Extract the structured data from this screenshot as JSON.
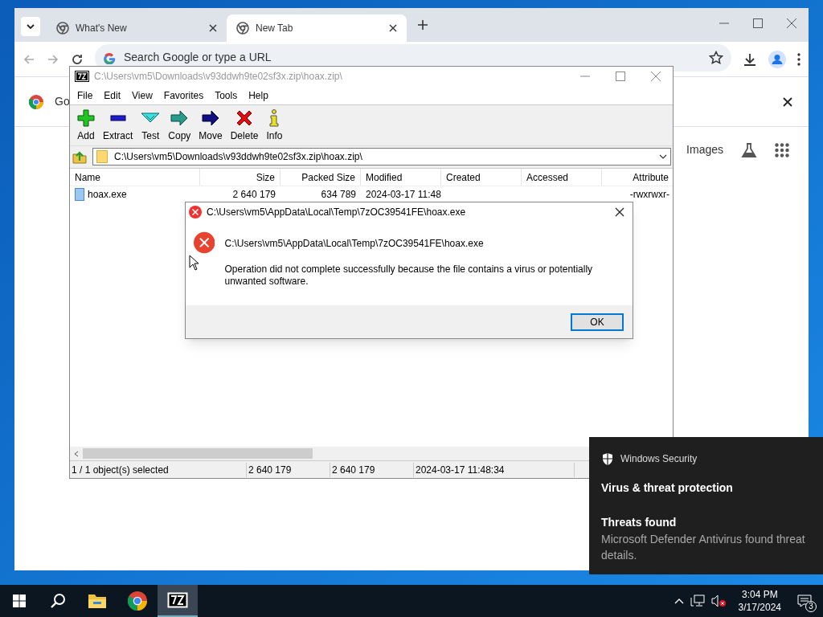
{
  "browser": {
    "tabs": [
      {
        "title": "What's New",
        "selected": false
      },
      {
        "title": "New Tab",
        "selected": true
      }
    ],
    "omnibox": {
      "placeholder": "Search Google or type a URL"
    },
    "banner": {
      "text": "Go"
    },
    "page_links": [
      "Images"
    ]
  },
  "archiver": {
    "title": "C:\\Users\\vm5\\Downloads\\v93ddwh9te02sf3x.zip\\hoax.zip\\",
    "menu": [
      "File",
      "Edit",
      "View",
      "Favorites",
      "Tools",
      "Help"
    ],
    "toolbar": [
      {
        "label": "Add",
        "kind": "add"
      },
      {
        "label": "Extract",
        "kind": "extract"
      },
      {
        "label": "Test",
        "kind": "test"
      },
      {
        "label": "Copy",
        "kind": "copy"
      },
      {
        "label": "Move",
        "kind": "move"
      },
      {
        "label": "Delete",
        "kind": "delete"
      },
      {
        "label": "Info",
        "kind": "info"
      }
    ],
    "path": "C:\\Users\\vm5\\Downloads\\v93ddwh9te02sf3x.zip\\hoax.zip\\",
    "columns": [
      "Name",
      "Size",
      "Packed Size",
      "Modified",
      "Created",
      "Accessed",
      "Attribute"
    ],
    "rows": [
      {
        "name": "hoax.exe",
        "size": "2 640 179",
        "packed_size": "634 789",
        "modified": "2024-03-17 11:48",
        "attributes": "-rwxrwxr-"
      }
    ],
    "status": [
      "1 / 1 object(s) selected",
      "2 640 179",
      "2 640 179",
      "2024-03-17 11:48:34"
    ]
  },
  "dialog": {
    "title": "C:\\Users\\vm5\\AppData\\Local\\Temp\\7zOC39541FE\\hoax.exe",
    "path": "C:\\Users\\vm5\\AppData\\Local\\Temp\\7zOC39541FE\\hoax.exe",
    "message": "Operation did not complete successfully because the file contains a virus or potentially unwanted software.",
    "button": "OK"
  },
  "toast": {
    "app": "Windows Security",
    "title": "Virus & threat protection",
    "heading": "Threats found",
    "lines": [
      "Microsoft Defender Antivirus found threat",
      "details."
    ]
  },
  "taskbar": {
    "apps": [
      {
        "kind": "explorer",
        "selected": false
      },
      {
        "kind": "chrome",
        "selected": false
      },
      {
        "kind": "sevenzip",
        "selected": true
      }
    ],
    "time": "3:04 PM",
    "date": "3/17/2024",
    "notifications": "3"
  }
}
